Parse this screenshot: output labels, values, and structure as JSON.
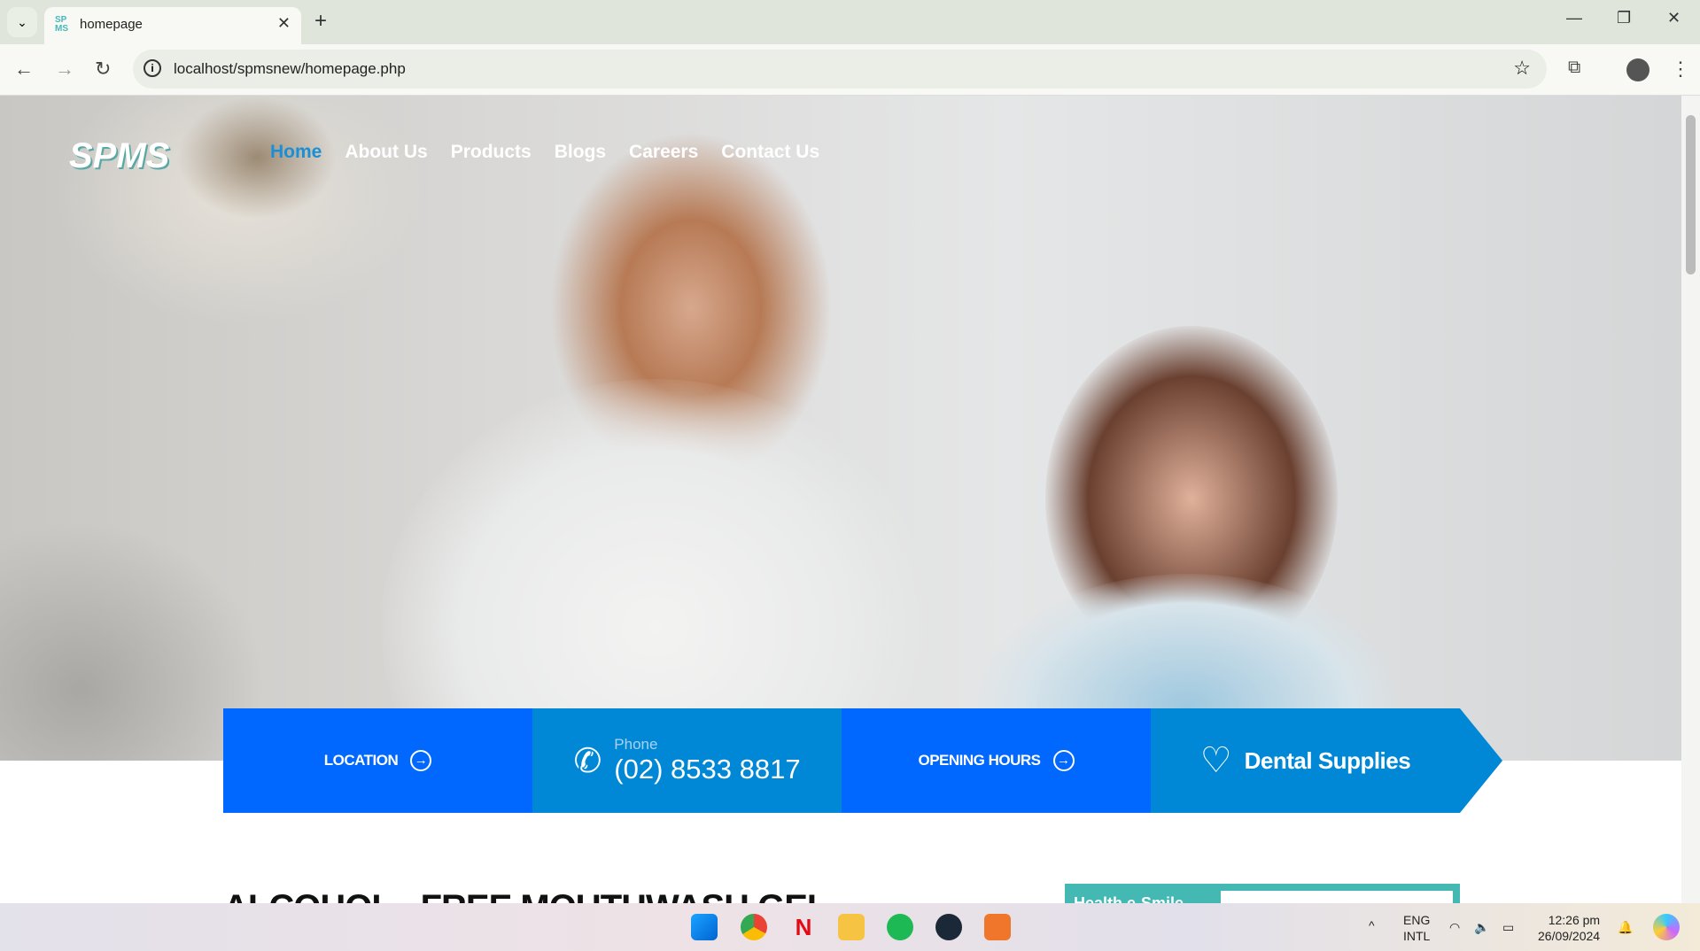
{
  "browser": {
    "tab_title": "homepage",
    "url": "localhost/spmsnew/homepage.php"
  },
  "site": {
    "logo": "SPMS",
    "nav": [
      "Home",
      "About Us",
      "Products",
      "Blogs",
      "Careers",
      "Contact Us"
    ],
    "active_nav": "Home",
    "info_boxes": {
      "location": "LOCATION",
      "phone_label": "Phone",
      "phone": "(02) 8533 8817",
      "hours": "OPENING HOURS",
      "supplies": "Dental Supplies"
    },
    "section_heading": "ALCOHOL - FREE MOUTHWASH GEL",
    "promo_text": "Health e-Smile",
    "colors": {
      "blue": "#0068ff",
      "blue2": "#0088d6",
      "teal": "#44b8b3",
      "active_nav": "#1a8fd6"
    }
  },
  "taskbar": {
    "lang": "ENG",
    "layout": "INTL",
    "time": "12:26 pm",
    "date": "26/09/2024"
  }
}
